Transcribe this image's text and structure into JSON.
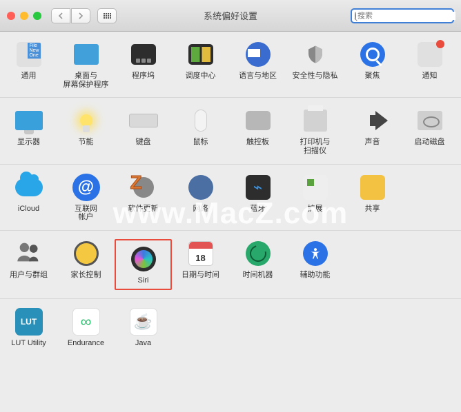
{
  "window": {
    "title": "系统偏好设置"
  },
  "search": {
    "value": "",
    "placeholder": "搜索"
  },
  "watermark": "www.MacZ.com",
  "highlighted_item": "siri",
  "rows": [
    [
      {
        "id": "general",
        "label": "通用"
      },
      {
        "id": "desktop",
        "label": "桌面与\n屏幕保护程序"
      },
      {
        "id": "dock",
        "label": "程序坞"
      },
      {
        "id": "mission-control",
        "label": "调度中心"
      },
      {
        "id": "language",
        "label": "语言与地区"
      },
      {
        "id": "security",
        "label": "安全性与隐私"
      },
      {
        "id": "spotlight",
        "label": "聚焦"
      },
      {
        "id": "notifications",
        "label": "通知"
      }
    ],
    [
      {
        "id": "displays",
        "label": "显示器"
      },
      {
        "id": "energy",
        "label": "节能"
      },
      {
        "id": "keyboard",
        "label": "键盘"
      },
      {
        "id": "mouse",
        "label": "鼠标"
      },
      {
        "id": "trackpad",
        "label": "触控板"
      },
      {
        "id": "printers",
        "label": "打印机与\n扫描仪"
      },
      {
        "id": "sound",
        "label": "声音"
      },
      {
        "id": "startup-disk",
        "label": "启动磁盘"
      }
    ],
    [
      {
        "id": "icloud",
        "label": "iCloud"
      },
      {
        "id": "internet-accounts",
        "label": "互联网\n帐户"
      },
      {
        "id": "software-update",
        "label": "软件更新"
      },
      {
        "id": "network",
        "label": "网络"
      },
      {
        "id": "bluetooth",
        "label": "蓝牙"
      },
      {
        "id": "extensions",
        "label": "扩展"
      },
      {
        "id": "sharing",
        "label": "共享"
      }
    ],
    [
      {
        "id": "users",
        "label": "用户与群组"
      },
      {
        "id": "parental",
        "label": "家长控制"
      },
      {
        "id": "siri",
        "label": "Siri"
      },
      {
        "id": "date-time",
        "label": "日期与时间"
      },
      {
        "id": "time-machine",
        "label": "时间机器"
      },
      {
        "id": "accessibility",
        "label": "辅助功能"
      }
    ],
    [
      {
        "id": "lut-utility",
        "label": "LUT Utility"
      },
      {
        "id": "endurance",
        "label": "Endurance"
      },
      {
        "id": "java",
        "label": "Java"
      }
    ]
  ]
}
